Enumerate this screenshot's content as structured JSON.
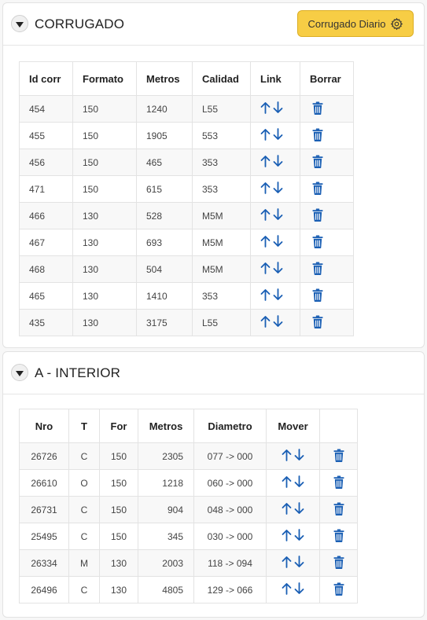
{
  "corrugado": {
    "title": "CORRUGADO",
    "button_label": "Corrugado Diario",
    "button_icon": "gear-icon",
    "columns": [
      "Id corr",
      "Formato",
      "Metros",
      "Calidad",
      "Link",
      "Borrar"
    ],
    "rows": [
      {
        "id": "454",
        "formato": "150",
        "metros": "1240",
        "calidad": "L55"
      },
      {
        "id": "455",
        "formato": "150",
        "metros": "1905",
        "calidad": "553"
      },
      {
        "id": "456",
        "formato": "150",
        "metros": "465",
        "calidad": "353"
      },
      {
        "id": "471",
        "formato": "150",
        "metros": "615",
        "calidad": "353"
      },
      {
        "id": "466",
        "formato": "130",
        "metros": "528",
        "calidad": "M5M"
      },
      {
        "id": "467",
        "formato": "130",
        "metros": "693",
        "calidad": "M5M"
      },
      {
        "id": "468",
        "formato": "130",
        "metros": "504",
        "calidad": "M5M"
      },
      {
        "id": "465",
        "formato": "130",
        "metros": "1410",
        "calidad": "353"
      },
      {
        "id": "435",
        "formato": "130",
        "metros": "3175",
        "calidad": "L55"
      }
    ]
  },
  "interior": {
    "title": "A - INTERIOR",
    "columns": [
      "Nro",
      "T",
      "For",
      "Metros",
      "Diametro",
      "Mover",
      ""
    ],
    "rows": [
      {
        "nro": "26726",
        "t": "C",
        "for": "150",
        "metros": "2305",
        "diametro": "077 -> 000"
      },
      {
        "nro": "26610",
        "t": "O",
        "for": "150",
        "metros": "1218",
        "diametro": "060 -> 000"
      },
      {
        "nro": "26731",
        "t": "C",
        "for": "150",
        "metros": "904",
        "diametro": "048 -> 000"
      },
      {
        "nro": "25495",
        "t": "C",
        "for": "150",
        "metros": "345",
        "diametro": "030 -> 000"
      },
      {
        "nro": "26334",
        "t": "M",
        "for": "130",
        "metros": "2003",
        "diametro": "118 -> 094"
      },
      {
        "nro": "26496",
        "t": "C",
        "for": "130",
        "metros": "4805",
        "diametro": "129 -> 066"
      }
    ]
  },
  "colors": {
    "icon_blue": "#1a5fb4",
    "button_yellow": "#f7cd45"
  }
}
